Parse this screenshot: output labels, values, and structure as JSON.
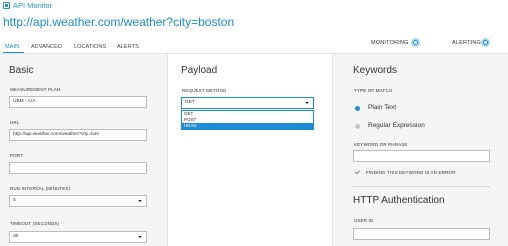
{
  "app": {
    "title": "API Monitor"
  },
  "header": {
    "url_title": "http://api.weather.com/weather?city=boston"
  },
  "status": {
    "monitoring_label": "MONITORING",
    "alerting_label": "ALERTING"
  },
  "tabs": [
    {
      "label": "MAIN",
      "active": true
    },
    {
      "label": "ADVANCED"
    },
    {
      "label": "LOCATIONS"
    },
    {
      "label": "ALERTS"
    }
  ],
  "basic": {
    "heading": "Basic",
    "measurement_plan": {
      "label": "MEASUREMENT PLAN",
      "value": "UBM - A/A"
    },
    "url": {
      "label": "URL",
      "value": "http://api.weather.com/weather?city=bos"
    },
    "port": {
      "label": "PORT",
      "value": ""
    },
    "run_interval": {
      "label": "RUN INTERVAL (MINUTES)",
      "value": "5"
    },
    "timeout": {
      "label": "TIMEOUT (SECONDS)",
      "value": "30"
    }
  },
  "payload": {
    "heading": "Payload",
    "request_method": {
      "label": "REQUEST METHOD",
      "value": "GET",
      "options": [
        "GET",
        "POST",
        "HEAD"
      ],
      "highlighted": "HEAD"
    }
  },
  "keywords": {
    "heading": "Keywords",
    "type_of_match_label": "TYPE OF MATCH",
    "options": [
      {
        "label": "Plain Text",
        "selected": true
      },
      {
        "label": "Regular Expression",
        "selected": false
      }
    ],
    "keyword_label": "KEYWORD OR PHRASE",
    "keyword_value": "",
    "error_toggle_label": "FINDING THIS KEYWORD IS AN ERROR"
  },
  "http_auth": {
    "heading": "HTTP Authentication",
    "user_id_label": "USER ID",
    "user_id_value": ""
  },
  "colors": {
    "accent": "#1e8bd3",
    "panel": "#f5f5f5"
  }
}
